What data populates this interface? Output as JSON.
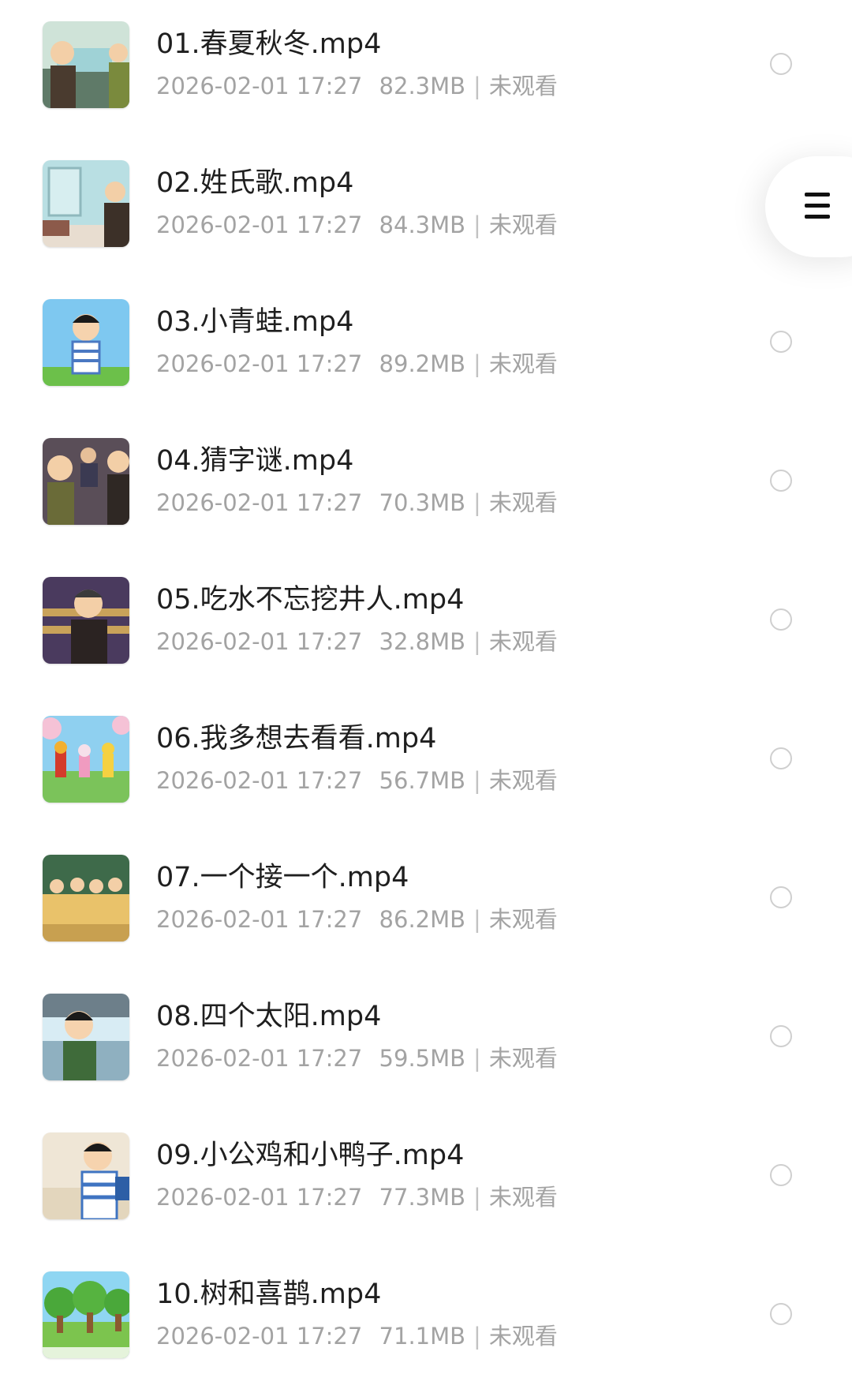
{
  "videos": [
    {
      "title": "01.春夏秋冬.mp4",
      "date": "2026-02-01 17:27",
      "size": "82.3MB",
      "status": "未观看"
    },
    {
      "title": "02.姓氏歌.mp4",
      "date": "2026-02-01 17:27",
      "size": "84.3MB",
      "status": "未观看"
    },
    {
      "title": "03.小青蛙.mp4",
      "date": "2026-02-01 17:27",
      "size": "89.2MB",
      "status": "未观看"
    },
    {
      "title": "04.猜字谜.mp4",
      "date": "2026-02-01 17:27",
      "size": "70.3MB",
      "status": "未观看"
    },
    {
      "title": "05.吃水不忘挖井人.mp4",
      "date": "2026-02-01 17:27",
      "size": "32.8MB",
      "status": "未观看"
    },
    {
      "title": "06.我多想去看看.mp4",
      "date": "2026-02-01 17:27",
      "size": "56.7MB",
      "status": "未观看"
    },
    {
      "title": "07.一个接一个.mp4",
      "date": "2026-02-01 17:27",
      "size": "86.2MB",
      "status": "未观看"
    },
    {
      "title": "08.四个太阳.mp4",
      "date": "2026-02-01 17:27",
      "size": "59.5MB",
      "status": "未观看"
    },
    {
      "title": "09.小公鸡和小鸭子.mp4",
      "date": "2026-02-01 17:27",
      "size": "77.3MB",
      "status": "未观看"
    },
    {
      "title": "10.树和喜鹊.mp4",
      "date": "2026-02-01 17:27",
      "size": "71.1MB",
      "status": "未观看"
    }
  ],
  "separator": "|",
  "menu_icon": "hamburger-menu-icon",
  "colors": {
    "title": "#1f1f1f",
    "meta": "#a3a3a3",
    "radio_border": "#cfcfcf"
  }
}
